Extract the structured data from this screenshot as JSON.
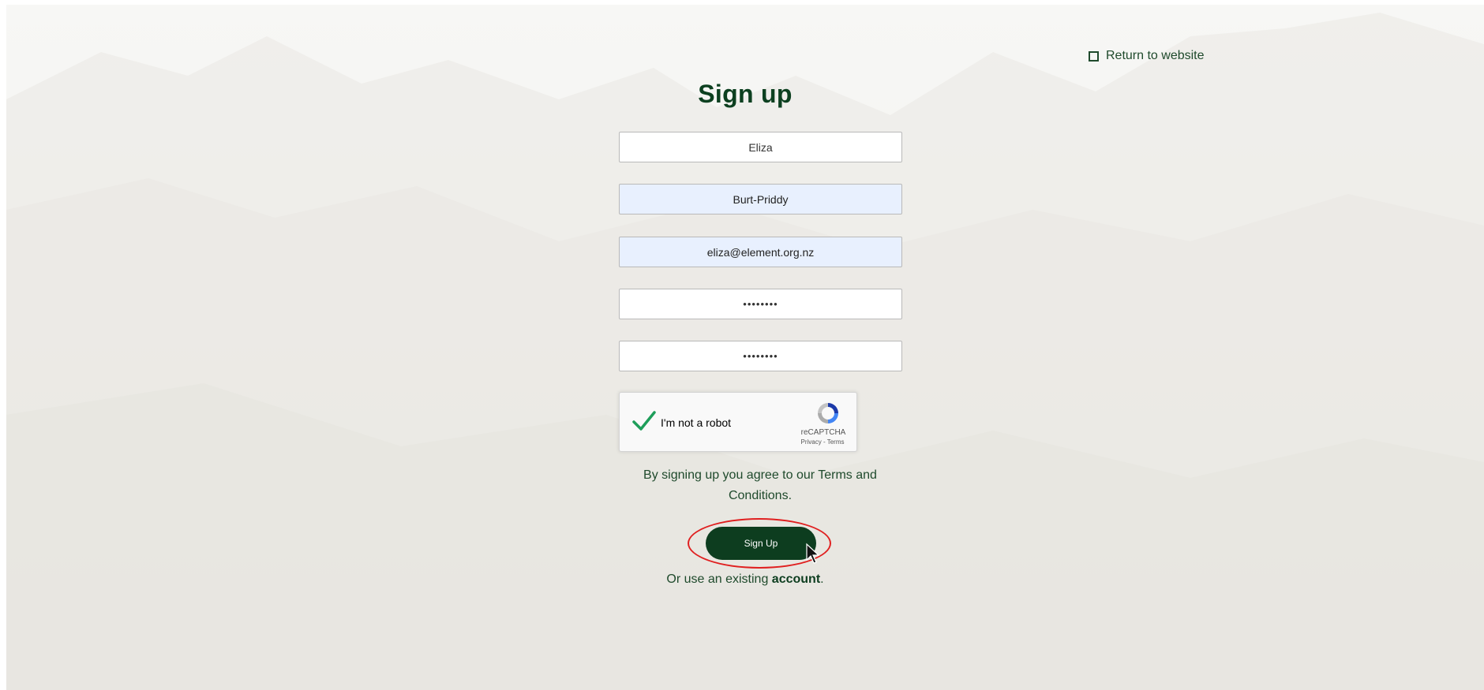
{
  "nav": {
    "return_label": "Return to website"
  },
  "form": {
    "title": "Sign up",
    "first_name_value": "Eliza",
    "last_name_value": "Burt-Priddy",
    "email_value": "eliza@element.org.nz",
    "password_value": "••••••••",
    "confirm_password_value": "••••••••",
    "terms_text": "By signing up you agree to our Terms and Conditions.",
    "submit_label": "Sign Up",
    "existing_prefix": "Or use an existing ",
    "existing_link": "account",
    "existing_suffix": "."
  },
  "captcha": {
    "label": "I'm not a robot",
    "brand": "reCAPTCHA",
    "privacy_label": "Privacy",
    "separator": " - ",
    "terms_label": "Terms",
    "checked": true
  },
  "icons": {
    "return": "square-outline-icon",
    "captcha_check": "checkmark-icon",
    "captcha_logo": "recaptcha-logo-icon",
    "cursor": "mouse-pointer-icon"
  },
  "colors": {
    "brand_dark_green": "#0d3d1f",
    "text_green": "#1f4a2c",
    "autofill_bg": "#e8f0fe",
    "check_green": "#1e9e5a",
    "highlight_red": "#e02020"
  }
}
